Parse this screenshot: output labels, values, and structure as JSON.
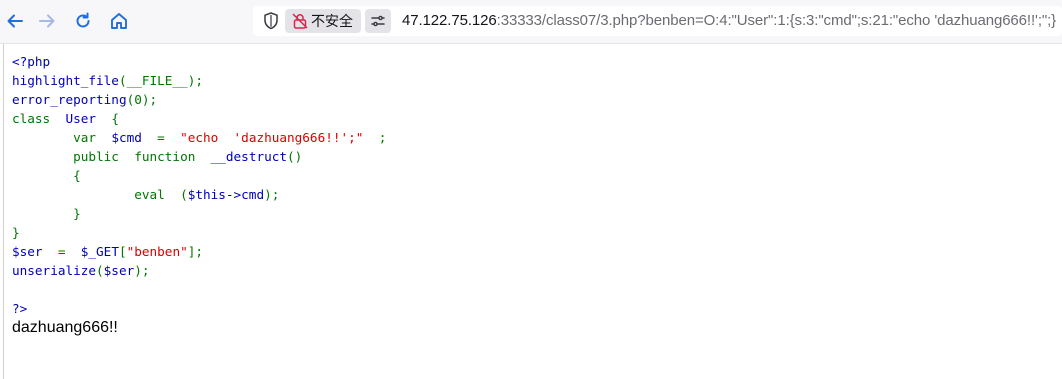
{
  "browser": {
    "security_label": "不安全",
    "url_host": "47.122.75.126",
    "url_rest": ":33333/class07/3.php?benben=O:4:\"User\":1:{s:3:\"cmd\";s:21:\"echo 'dazhuang666!!';\";}",
    "icons": [
      "back-arrow-icon",
      "forward-arrow-icon",
      "reload-icon",
      "home-icon",
      "shield-icon",
      "lock-slash-icon",
      "permissions-icon"
    ]
  },
  "source": {
    "open_tag": "<?php",
    "l_highlight_fn": "highlight_file",
    "l_highlight_arg": "(__FILE__);",
    "l_error_fn": "error_reporting",
    "l_error_arg": "(0);",
    "kw_class": "class",
    "class_name": "User",
    "brace_open": "{",
    "kw_var": "var",
    "var_cmd": "$cmd",
    "eq": "=",
    "str_cmd": "\"echo  'dazhuang666!!';\"",
    "semicolon": ";",
    "kw_public": "public",
    "kw_function": "function",
    "fn_destruct": "__destruct",
    "parens": "()",
    "kw_eval": "eval",
    "eval_arg_open": "(",
    "eval_arg": "$this->cmd",
    "eval_arg_close": ");",
    "brace_close": "}",
    "var_ser": "$ser",
    "get_var": "$_GET",
    "bracket_open": "[",
    "str_benben": "\"benben\"",
    "bracket_close": "];",
    "fn_unserialize": "unserialize",
    "unserialize_arg_open": "(",
    "unserialize_arg": "$ser",
    "unserialize_arg_close": ");",
    "close_tag": "?>"
  },
  "output": {
    "text": "dazhuang666!!"
  },
  "colors": {
    "php_default": "#0000bb",
    "php_keyword": "#007700",
    "php_string": "#dd0000",
    "nav_icon": "#1f6fe0"
  }
}
